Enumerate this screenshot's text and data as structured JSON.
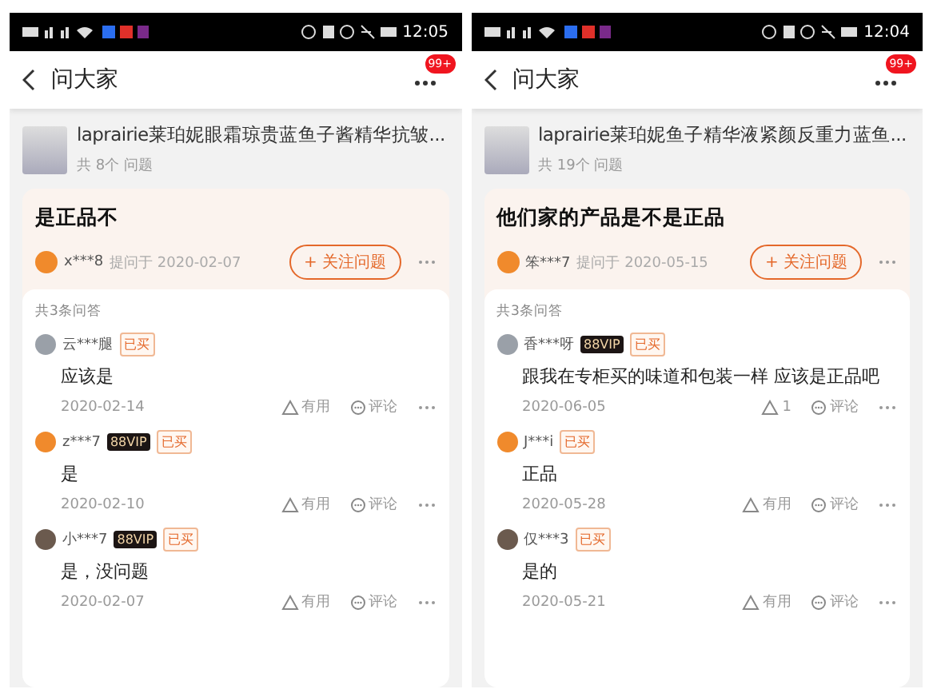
{
  "phones": [
    {
      "status_bar": {
        "time": "12:05"
      },
      "header": {
        "title": "问大家",
        "badge": "99+"
      },
      "product": {
        "title": "laprairie莱珀妮眼霜琼贵蓝鱼子酱精华抗皱...",
        "count": "共 8个 问题"
      },
      "question": {
        "title": "是正品不",
        "asker": "x***8",
        "asked": "提问于 2020-02-07",
        "follow": "+ 关注问题"
      },
      "answers": {
        "count": "共3条问答",
        "items": [
          {
            "name": "云***腿",
            "badges": [
              {
                "kind": "bought",
                "label": "已买"
              }
            ],
            "text": "应该是",
            "date": "2020-02-14",
            "useful": "有用",
            "comment": "评论"
          },
          {
            "name": "z***7",
            "badges": [
              {
                "kind": "vip",
                "label": "88VIP"
              },
              {
                "kind": "bought",
                "label": "已买"
              }
            ],
            "text": "是",
            "date": "2020-02-10",
            "useful": "有用",
            "comment": "评论"
          },
          {
            "name": "小***7",
            "badges": [
              {
                "kind": "vip",
                "label": "88VIP"
              },
              {
                "kind": "bought",
                "label": "已买"
              }
            ],
            "text": "是，没问题",
            "date": "2020-02-07",
            "useful": "有用",
            "comment": "评论"
          }
        ]
      }
    },
    {
      "status_bar": {
        "time": "12:04"
      },
      "header": {
        "title": "问大家",
        "badge": "99+"
      },
      "product": {
        "title": "laprairie莱珀妮鱼子精华液紧颜反重力蓝鱼...",
        "count": "共 19个 问题"
      },
      "question": {
        "title": "他们家的产品是不是正品",
        "asker": "笨***7",
        "asked": "提问于 2020-05-15",
        "follow": "+ 关注问题"
      },
      "answers": {
        "count": "共3条问答",
        "items": [
          {
            "name": "香***呀",
            "badges": [
              {
                "kind": "vip",
                "label": "88VIP"
              },
              {
                "kind": "bought",
                "label": "已买"
              }
            ],
            "text": "跟我在专柜买的味道和包装一样  应该是正品吧",
            "date": "2020-06-05",
            "useful": "1",
            "comment": "评论"
          },
          {
            "name": "J***i",
            "badges": [
              {
                "kind": "bought",
                "label": "已买"
              }
            ],
            "text": "正品",
            "date": "2020-05-28",
            "useful": "有用",
            "comment": "评论"
          },
          {
            "name": "仅***3",
            "badges": [
              {
                "kind": "bought",
                "label": "已买"
              }
            ],
            "text": "是的",
            "date": "2020-05-21",
            "useful": "有用",
            "comment": "评论"
          }
        ]
      }
    }
  ]
}
